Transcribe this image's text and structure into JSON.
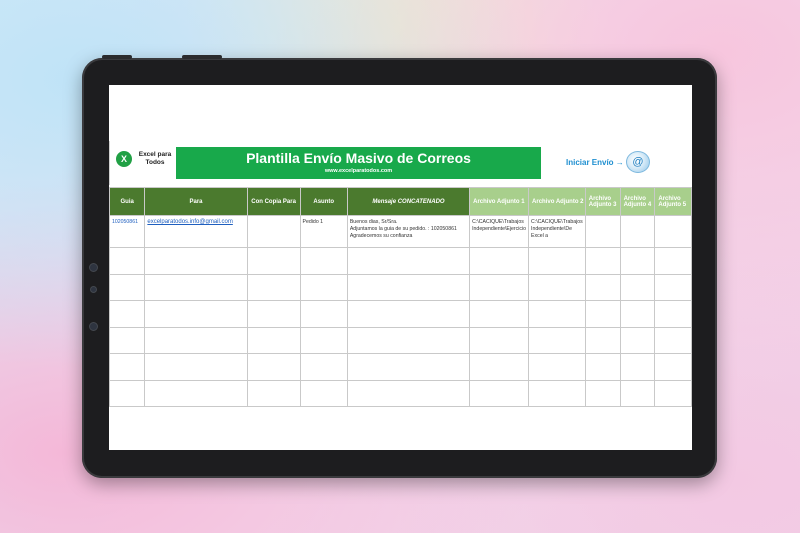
{
  "header": {
    "logo_text": "Excel para Todos",
    "logo_glyph": "X",
    "title": "Plantilla Envío Masivo de Correos",
    "url": "www.excelparatodos.com",
    "send_label": "Iniciar Envío →",
    "send_icon": "@"
  },
  "table": {
    "columns": [
      "Guia",
      "Para",
      "Con Copia Para",
      "Asunto",
      "Mensaje CONCATENADO",
      "Archivo Adjunto 1",
      "Archivo Adjunto 2",
      "Archivo Adjunto 3",
      "Archivo Adjunto 4",
      "Archivo Adjunto 5"
    ],
    "row1": {
      "guia": "102050861",
      "para": "excelparatodos.info@gmail.com",
      "cc": "",
      "asunto": "Pedido 1",
      "mensaje_1": "Buenos dias, Sr/Sra.",
      "mensaje_2": "Adjuntamos la guia de su pedido. : 102050861",
      "mensaje_3": "Agradecemos su confianza",
      "adjunto1": "C:\\CACIQUE\\Trabajos Independiente\\Ejercicio",
      "adjunto2": "C:\\CACIQUE\\Trabajos Independiente\\De Excel a",
      "adjunto3": "",
      "adjunto4": "",
      "adjunto5": ""
    }
  },
  "colors": {
    "title_green": "#18a94b",
    "header_dark_green": "#4b7a2e",
    "header_light_green": "#a8cf8c",
    "link_blue": "#1f5fbf",
    "send_blue": "#1f8fd0"
  }
}
